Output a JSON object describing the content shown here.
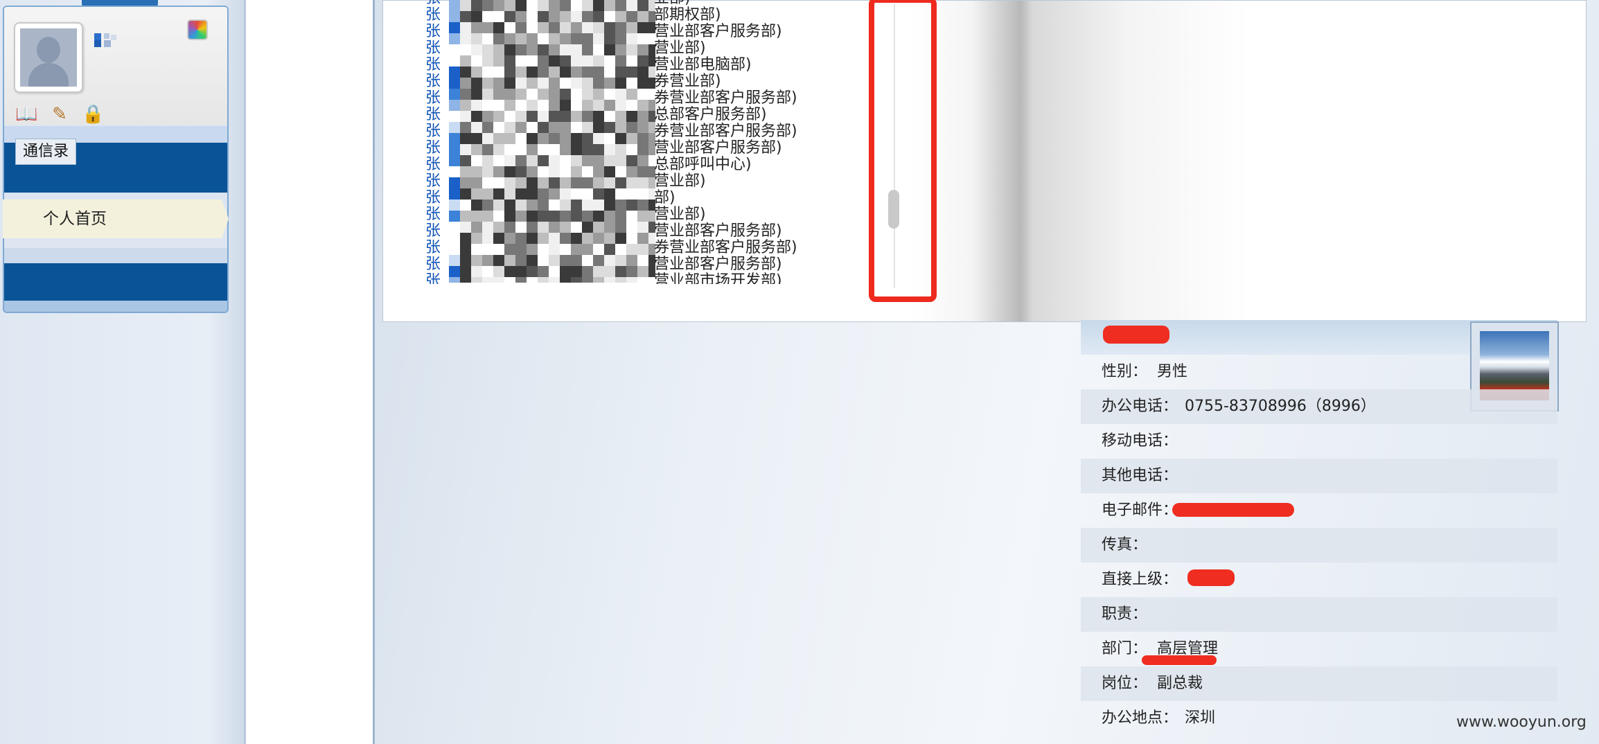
{
  "sidebar": {
    "contacts_tab": "通信录",
    "home_item": "个人首页"
  },
  "popup": {
    "name_prefix": "张",
    "departments": [
      "业部)",
      "部期权部)",
      "营业部客户服务部)",
      "营业部)",
      "营业部电脑部)",
      "券营业部)",
      "券营业部客户服务部)",
      "总部客户服务部)",
      "券营业部客户服务部)",
      "营业部客户服务部)",
      "总部呼叫中心)",
      "营业部)",
      "部)",
      "营业部)",
      "营业部客户服务部)",
      "券营业部客户服务部)",
      "营业部客户服务部)",
      "营业部市场开发部)"
    ]
  },
  "detail": {
    "rows": [
      {
        "label": "性别：",
        "value": "男性"
      },
      {
        "label": "办公电话：",
        "value": "0755-83708996（8996）"
      },
      {
        "label": "移动电话：",
        "value": ""
      },
      {
        "label": "其他电话：",
        "value": ""
      },
      {
        "label": "电子邮件：",
        "value": ""
      },
      {
        "label": "传真：",
        "value": ""
      },
      {
        "label": "直接上级：",
        "value": ""
      },
      {
        "label": "职责：",
        "value": ""
      },
      {
        "label": "部门：",
        "value": "高层管理"
      },
      {
        "label": "岗位：",
        "value": "副总裁"
      },
      {
        "label": "办公地点：",
        "value": "深圳"
      }
    ]
  },
  "watermark": "www.wooyun.org",
  "colors": {
    "nav_blue": "#0a5396",
    "link_blue": "#1255b6",
    "highlight_red": "#ee2a1e"
  },
  "icons": [
    "user-avatar-icon",
    "skin-color-icon",
    "address-book-icon",
    "notepad-icon",
    "lock-icon",
    "scenery-photo-icon"
  ]
}
